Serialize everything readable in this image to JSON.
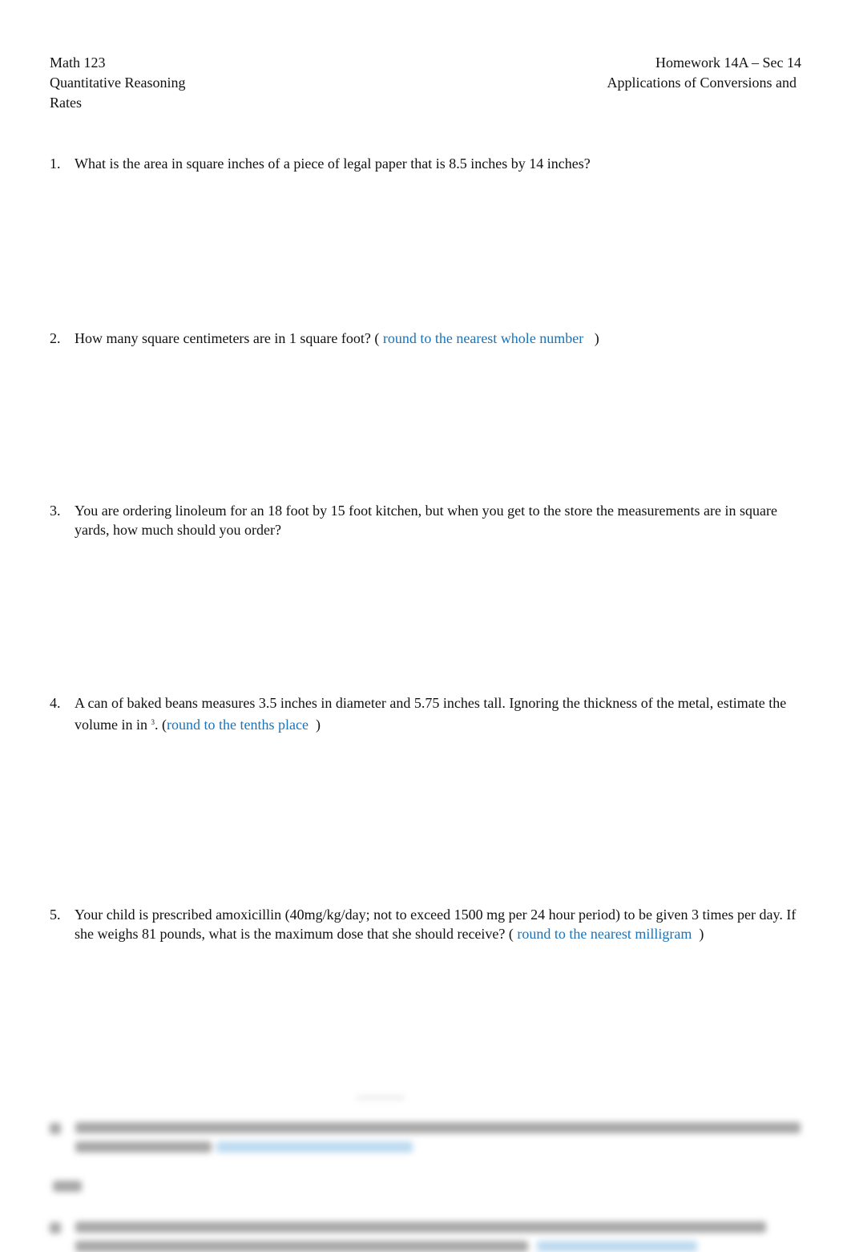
{
  "header": {
    "left": [
      "Math 123",
      "Quantitative Reasoning",
      "Rates"
    ],
    "right": [
      "Homework 14A – Sec 14",
      "Applications of Conversions and"
    ]
  },
  "questions": [
    {
      "number": "1.",
      "text": "What is the area in square inches of a piece of legal paper that is 8.5 inches by 14 inches?"
    },
    {
      "number": "2.",
      "text": "How many square centimeters are in 1 square foot? ( ",
      "hint": "round to the nearest whole number",
      "after": "   )"
    },
    {
      "number": "3.",
      "text": "You are ordering linoleum for an 18 foot by 15 foot kitchen, but when you get to the store the measurements are in square yards, how much should you order?"
    },
    {
      "number": "4.",
      "text": "A can of baked beans measures 3.5 inches in diameter and 5.75 inches tall. Ignoring the thickness of the metal, estimate the volume in in ",
      "sup": "3",
      "text2": ". (",
      "hint": "round to the tenths place",
      "after": "  )"
    },
    {
      "number": "5.",
      "text": "Your child is prescribed amoxicillin (40mg/kg/day; not to exceed 1500 mg per 24 hour period) to be given 3 times per day. If she weighs 81 pounds, what is the maximum dose that she should receive? ( ",
      "hint": "round to the nearest milligram",
      "after": "  )"
    }
  ],
  "blurred_section": {
    "state": "blurred-preview"
  },
  "colors": {
    "text": "#111111",
    "hint": "#1a73b8",
    "background": "#ffffff"
  }
}
